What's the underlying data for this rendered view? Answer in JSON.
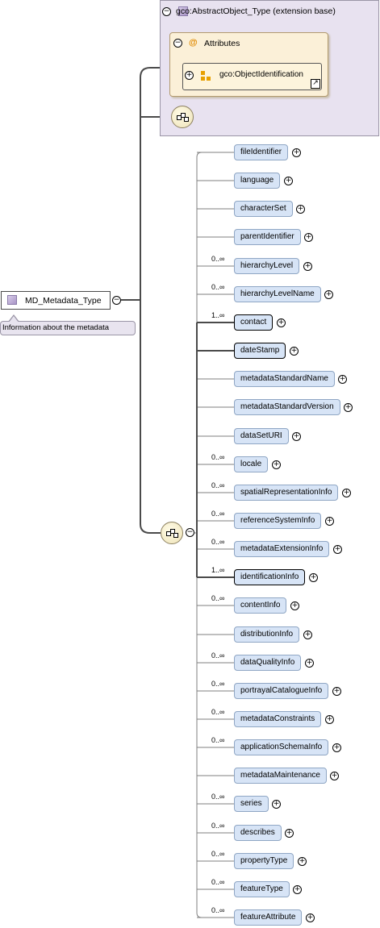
{
  "extension_base": {
    "title": "gco:AbstractObject_Type (extension base)"
  },
  "attributes": {
    "title": "Attributes",
    "item": "gco:ObjectIdentification"
  },
  "root": {
    "label": "MD_Metadata_Type",
    "documentation": "Information about the metadata"
  },
  "elements": [
    {
      "name": "fileIdentifier",
      "card": "",
      "required": false
    },
    {
      "name": "language",
      "card": "",
      "required": false
    },
    {
      "name": "characterSet",
      "card": "",
      "required": false
    },
    {
      "name": "parentIdentifier",
      "card": "",
      "required": false
    },
    {
      "name": "hierarchyLevel",
      "card": "0..∞",
      "required": false
    },
    {
      "name": "hierarchyLevelName",
      "card": "0..∞",
      "required": false
    },
    {
      "name": "contact",
      "card": "1..∞",
      "required": true
    },
    {
      "name": "dateStamp",
      "card": "",
      "required": true
    },
    {
      "name": "metadataStandardName",
      "card": "",
      "required": false
    },
    {
      "name": "metadataStandardVersion",
      "card": "",
      "required": false
    },
    {
      "name": "dataSetURI",
      "card": "",
      "required": false
    },
    {
      "name": "locale",
      "card": "0..∞",
      "required": false
    },
    {
      "name": "spatialRepresentationInfo",
      "card": "0..∞",
      "required": false
    },
    {
      "name": "referenceSystemInfo",
      "card": "0..∞",
      "required": false
    },
    {
      "name": "metadataExtensionInfo",
      "card": "0..∞",
      "required": false
    },
    {
      "name": "identificationInfo",
      "card": "1..∞",
      "required": true
    },
    {
      "name": "contentInfo",
      "card": "0..∞",
      "required": false
    },
    {
      "name": "distributionInfo",
      "card": "",
      "required": false
    },
    {
      "name": "dataQualityInfo",
      "card": "0..∞",
      "required": false
    },
    {
      "name": "portrayalCatalogueInfo",
      "card": "0..∞",
      "required": false
    },
    {
      "name": "metadataConstraints",
      "card": "0..∞",
      "required": false
    },
    {
      "name": "applicationSchemaInfo",
      "card": "0..∞",
      "required": false
    },
    {
      "name": "metadataMaintenance",
      "card": "",
      "required": false
    },
    {
      "name": "series",
      "card": "0..∞",
      "required": false
    },
    {
      "name": "describes",
      "card": "0..∞",
      "required": false
    },
    {
      "name": "propertyType",
      "card": "0..∞",
      "required": false
    },
    {
      "name": "featureType",
      "card": "0..∞",
      "required": false
    },
    {
      "name": "featureAttribute",
      "card": "0..∞",
      "required": false
    }
  ],
  "icons": {
    "collapse": "minus-circle",
    "expand": "plus-circle",
    "sequence": "sequence-compositor",
    "attribute": "at-sign",
    "type": "complex-type",
    "link": "arrow-link"
  }
}
